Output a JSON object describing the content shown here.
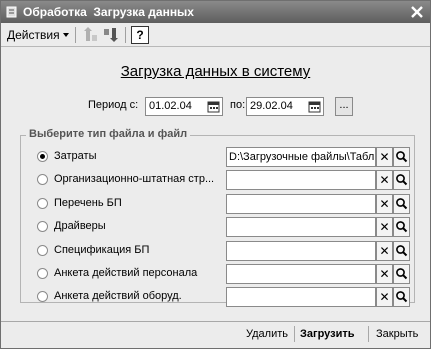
{
  "window": {
    "title": "Обработка  Загрузка данных"
  },
  "toolbar": {
    "actions_label": "Действия",
    "help_label": "?"
  },
  "heading": "Загрузка данных в систему",
  "period": {
    "from_label": "Период с:",
    "from_value": "01.02.04",
    "to_label": "по:",
    "to_value": "29.02.04",
    "more_label": "..."
  },
  "group": {
    "title": "Выберите тип файла и файл"
  },
  "rows": [
    {
      "label": "Затраты",
      "selected": true,
      "path": "D:\\Загрузочные файлы\\Табл"
    },
    {
      "label": "Организационно-штатная стр...",
      "selected": false,
      "path": ""
    },
    {
      "label": "Перечень БП",
      "selected": false,
      "path": ""
    },
    {
      "label": "Драйверы",
      "selected": false,
      "path": ""
    },
    {
      "label": "Спецификация БП",
      "selected": false,
      "path": ""
    },
    {
      "label": "Анкета действий персонала",
      "selected": false,
      "path": ""
    },
    {
      "label": "Анкета действий оборуд.",
      "selected": false,
      "path": ""
    }
  ],
  "buttons": {
    "delete_label": "Удалить",
    "load_label": "Загрузить",
    "close_label": "Закрыть"
  },
  "icons": {
    "clear": "clear-icon",
    "search": "search-icon",
    "calendar": "calendar-icon"
  }
}
